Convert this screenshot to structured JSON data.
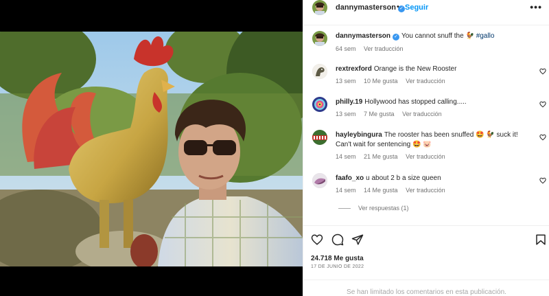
{
  "header": {
    "username": "dannymasterson",
    "separator": "•",
    "follow_label": "Seguir",
    "more_label": "•••"
  },
  "caption": {
    "username": "dannymasterson",
    "text": "You cannot snuff the 🐓",
    "hashtag": "#gallo",
    "time": "64 sem",
    "translate": "Ver traducción"
  },
  "comments": [
    {
      "username": "rextrexford",
      "text": "Orange is the New Rooster",
      "time": "13 sem",
      "likes": "10 Me gusta",
      "translate": "Ver traducción"
    },
    {
      "username": "philly.19",
      "text": "Hollywood has stopped calling.....",
      "time": "13 sem",
      "likes": "7 Me gusta",
      "translate": "Ver traducción"
    },
    {
      "username": "hayleybingura",
      "text": "The rooster has been snuffed 🤩 🐓 suck it! Can't wait for sentencing 🤩 🐷",
      "time": "14 sem",
      "likes": "21 Me gusta",
      "translate": "Ver traducción"
    },
    {
      "username": "faafo_xo",
      "text": "u about 2 b a size queen",
      "time": "14 sem",
      "likes": "14 Me gusta",
      "translate": "Ver traducción",
      "replies": "Ver respuestas (1)"
    }
  ],
  "footer": {
    "likes": "24.718 Me gusta",
    "date": "17 DE JUNIO DE 2022",
    "limited": "Se han limitado los comentarios en esta publicación."
  },
  "icons": {
    "heart": "heart-icon",
    "comment": "comment-icon",
    "share": "share-icon",
    "save": "bookmark-icon",
    "verified": "verified-badge-icon"
  },
  "colors": {
    "link_blue": "#0095f6",
    "verified_blue": "#3897f0",
    "hashtag": "#00376b",
    "muted": "#737373"
  }
}
